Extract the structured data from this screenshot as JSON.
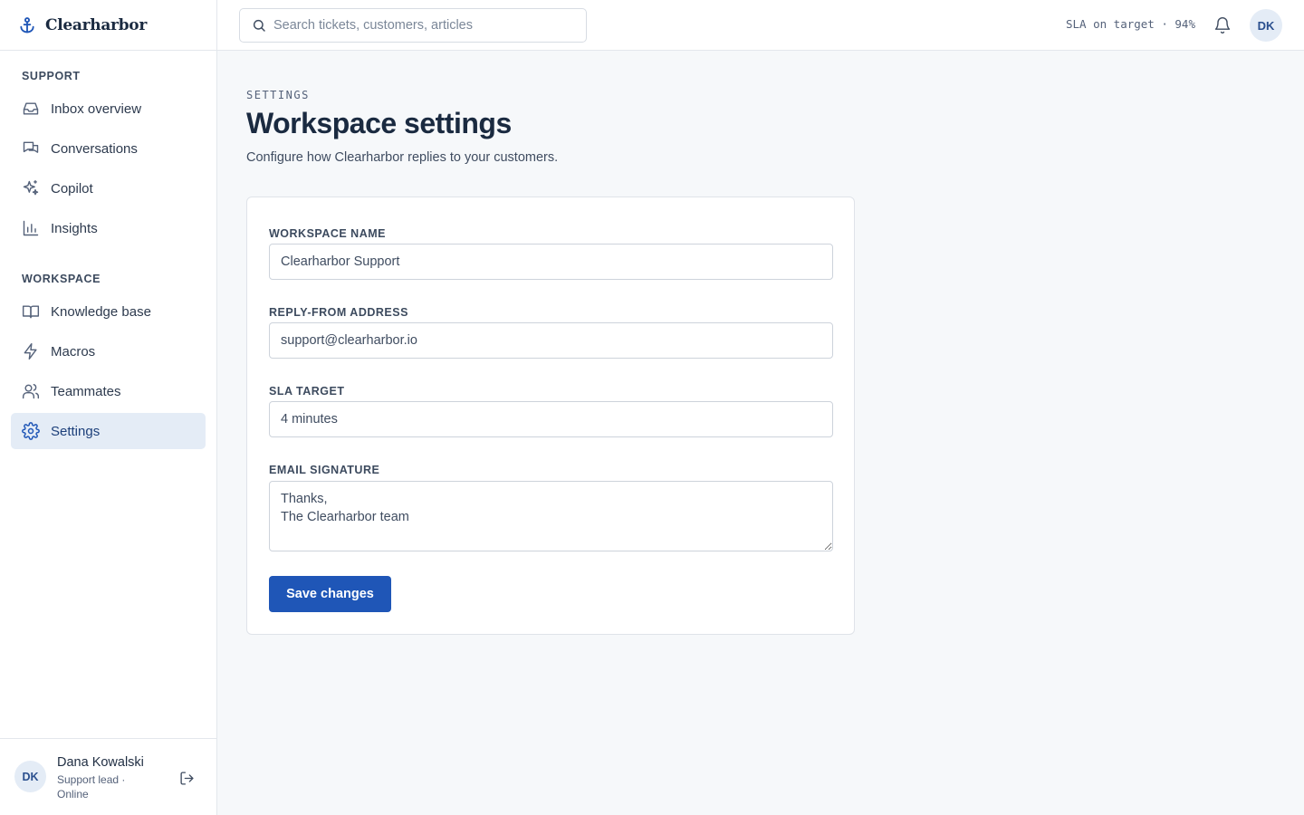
{
  "brand": {
    "name": "Clearharbor",
    "icon": "anchor-icon"
  },
  "sidebar": {
    "sections": [
      {
        "label": "SUPPORT",
        "items": [
          {
            "label": "Inbox overview",
            "icon": "inbox-icon"
          },
          {
            "label": "Conversations",
            "icon": "chat-bubbles-icon"
          },
          {
            "label": "Copilot",
            "icon": "sparkles-icon"
          },
          {
            "label": "Insights",
            "icon": "bar-chart-icon"
          }
        ]
      },
      {
        "label": "WORKSPACE",
        "items": [
          {
            "label": "Knowledge base",
            "icon": "book-icon"
          },
          {
            "label": "Macros",
            "icon": "bolt-icon"
          },
          {
            "label": "Teammates",
            "icon": "users-icon"
          },
          {
            "label": "Settings",
            "icon": "gear-icon",
            "active": true
          }
        ]
      }
    ],
    "user": {
      "initials": "DK",
      "name": "Dana Kowalski",
      "role": "Support lead · Online"
    }
  },
  "topbar": {
    "search_placeholder": "Search tickets, customers, articles",
    "sla_status": "SLA on target · 94%",
    "avatar_initials": "DK"
  },
  "page": {
    "eyebrow": "SETTINGS",
    "title": "Workspace settings",
    "subtitle": "Configure how Clearharbor replies to your customers."
  },
  "form": {
    "workspace_name": {
      "label": "WORKSPACE NAME",
      "value": "Clearharbor Support"
    },
    "reply_from": {
      "label": "REPLY-FROM ADDRESS",
      "value": "support@clearharbor.io"
    },
    "sla_target": {
      "label": "SLA TARGET",
      "value": "4 minutes"
    },
    "email_signature": {
      "label": "EMAIL SIGNATURE",
      "value": "Thanks,\nThe Clearharbor team"
    },
    "save_label": "Save changes"
  },
  "colors": {
    "accent": "#1f56b7",
    "active_nav_bg": "#e4ecf6",
    "text_dark": "#1a2a40"
  }
}
